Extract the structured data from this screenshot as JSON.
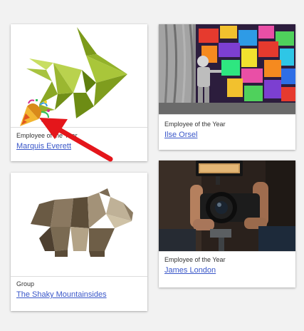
{
  "cards": [
    {
      "caption": "Employee of the Year",
      "name": "Marquis Everett",
      "image": "origami-fish"
    },
    {
      "caption": "Employee of the Year",
      "name": "Ilse Orsel",
      "image": "child-painting-curtain-photo"
    },
    {
      "caption": "Group",
      "name": "The Shaky Mountainsides",
      "image": "origami-bear"
    },
    {
      "caption": "Employee of the Year",
      "name": "James London",
      "image": "photographer-camera-photo"
    }
  ],
  "overlays": {
    "emoji": "party-popper-icon",
    "pointer": "red-arrow-icon"
  }
}
